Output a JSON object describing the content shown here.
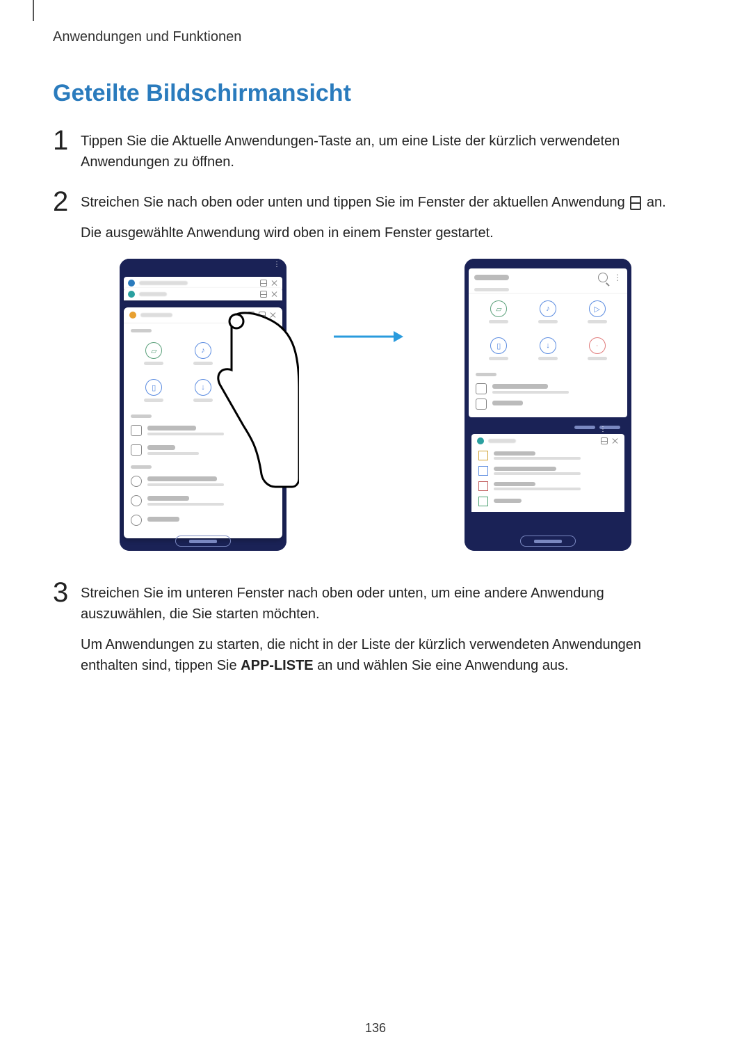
{
  "header": {
    "breadcrumb": "Anwendungen und Funktionen"
  },
  "title": "Geteilte Bildschirmansicht",
  "steps": {
    "s1": {
      "num": "1",
      "body": "Tippen Sie die Aktuelle Anwendungen-Taste an, um eine Liste der kürzlich verwendeten Anwendungen zu öffnen."
    },
    "s2": {
      "num": "2",
      "line1_a": "Streichen Sie nach oben oder unten und tippen Sie im Fenster der aktuellen Anwendung ",
      "line1_b": " an.",
      "line2": "Die ausgewählte Anwendung wird oben in einem Fenster gestartet."
    },
    "s3": {
      "num": "3",
      "p1": "Streichen Sie im unteren Fenster nach oben oder unten, um eine andere Anwendung auszuwählen, die Sie starten möchten.",
      "p2_a": "Um Anwendungen zu starten, die nicht in der Liste der kürzlich verwendeten Anwendungen enthalten sind, tippen Sie ",
      "p2_bold": "APP-LISTE",
      "p2_b": " an und wählen Sie eine Anwendung aus."
    }
  },
  "page_number": "136"
}
